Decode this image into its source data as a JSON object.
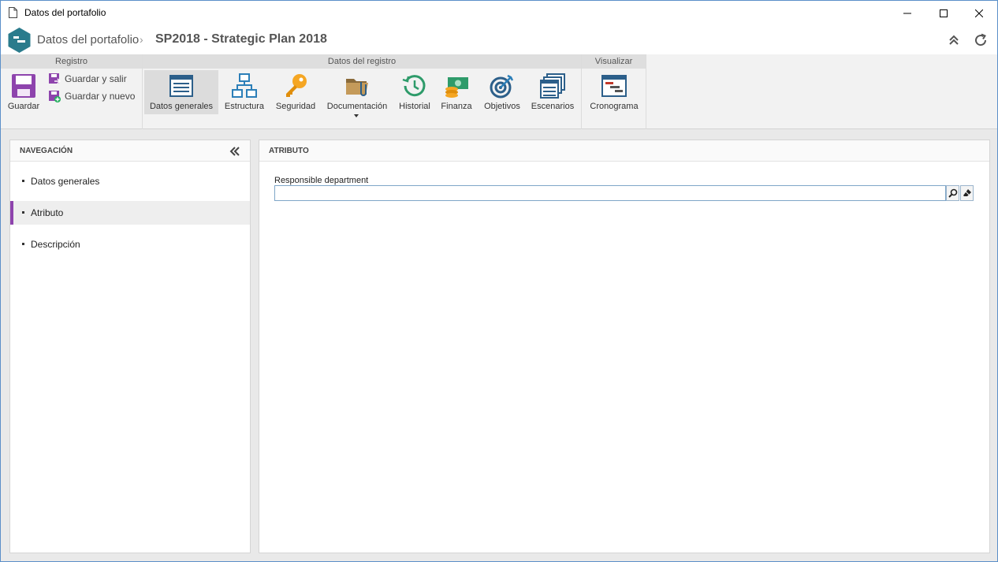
{
  "window": {
    "title": "Datos del portafolio"
  },
  "header": {
    "breadcrumb_root": "Datos del portafolio",
    "breadcrumb_separator": "›",
    "breadcrumb_current": "SP2018 - Strategic Plan 2018"
  },
  "ribbon": {
    "groups": {
      "registro": "Registro",
      "datos_registro": "Datos del registro",
      "visualizar": "Visualizar"
    },
    "buttons": {
      "guardar": "Guardar",
      "guardar_salir": "Guardar y salir",
      "guardar_nuevo": "Guardar y nuevo",
      "datos_generales": "Datos generales",
      "estructura": "Estructura",
      "seguridad": "Seguridad",
      "documentacion": "Documentación",
      "historial": "Historial",
      "finanza": "Finanza",
      "objetivos": "Objetivos",
      "escenarios": "Escenarios",
      "cronograma": "Cronograma"
    }
  },
  "navigation": {
    "title": "NAVEGACIÓN",
    "items": [
      {
        "label": "Datos generales",
        "selected": false
      },
      {
        "label": "Atributo",
        "selected": true
      },
      {
        "label": "Descripción",
        "selected": false
      }
    ]
  },
  "main": {
    "title": "ATRIBUTO",
    "field": {
      "label": "Responsible department",
      "value": ""
    }
  },
  "colors": {
    "accent_selected": "#8e44ad",
    "logo": "#2a7b8c",
    "input_border": "#7fa6c8"
  }
}
